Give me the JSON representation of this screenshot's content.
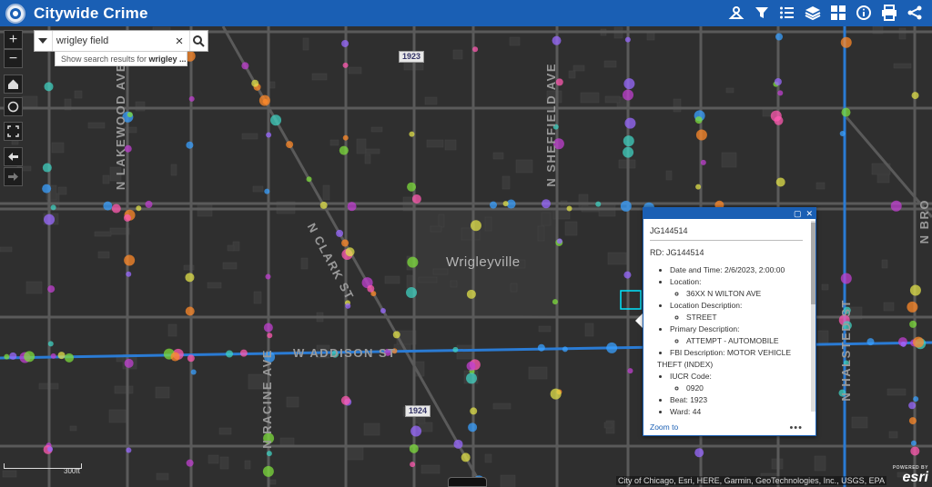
{
  "app": {
    "title": "Citywide Crime",
    "logo_icon": "city-seal-icon"
  },
  "toolbar": [
    {
      "name": "measure-tool-icon"
    },
    {
      "name": "filter-icon"
    },
    {
      "name": "legend-list-icon"
    },
    {
      "name": "layers-icon"
    },
    {
      "name": "basemap-gallery-icon"
    },
    {
      "name": "about-info-icon"
    },
    {
      "name": "print-icon"
    },
    {
      "name": "share-icon"
    }
  ],
  "search": {
    "value": "wrigley field",
    "suggest_prefix": "Show search results for ",
    "suggest_term": "wrigley ..."
  },
  "map_labels": {
    "neighborhood": "Wrigleyville",
    "lakewood": "N LAKEWOOD AVE",
    "sheffield": "N SHEFFIELD AVE",
    "clark": "N CLARK ST",
    "addison": "W ADDISON ST",
    "racine": "N RACINE AVE",
    "halsted": "N HALSTED ST",
    "broadway": "N BRO",
    "beat_top": "1923",
    "beat_bottom": "1924"
  },
  "popup": {
    "title": "JG144514",
    "rd": "RD: JG144514",
    "datetime_label": "Date and Time: 2/6/2023, 2:00:00",
    "location_label": "Location:",
    "location_value": "36XX N WILTON AVE",
    "location_desc_label": "Location Description:",
    "location_desc_value": "STREET",
    "primary_desc_label": "Primary Description:",
    "primary_desc_value": "ATTEMPT - AUTOMOBILE",
    "fbi_label": "FBI Description: ",
    "fbi_value_1": "MOTOR VEHICLE",
    "fbi_value_2": "THEFT (INDEX)",
    "iucr_label": "IUCR Code:",
    "iucr_value": "0920",
    "beat": "Beat: 1923",
    "ward": "Ward: 44",
    "zoom_link": "Zoom to",
    "more": "•••",
    "maximize": "▢",
    "close": "✕"
  },
  "footer": {
    "attribution": "City of Chicago, Esri, HERE, Garmin, GeoTechnologies, Inc., USGS, EPA",
    "powered": "POWERED BY",
    "esri": "esri",
    "scale": "300ft"
  },
  "colors": {
    "header": "#1a5fb4",
    "highlight_street": "#2a7bd4",
    "annotation_red": "#e01b1b"
  }
}
